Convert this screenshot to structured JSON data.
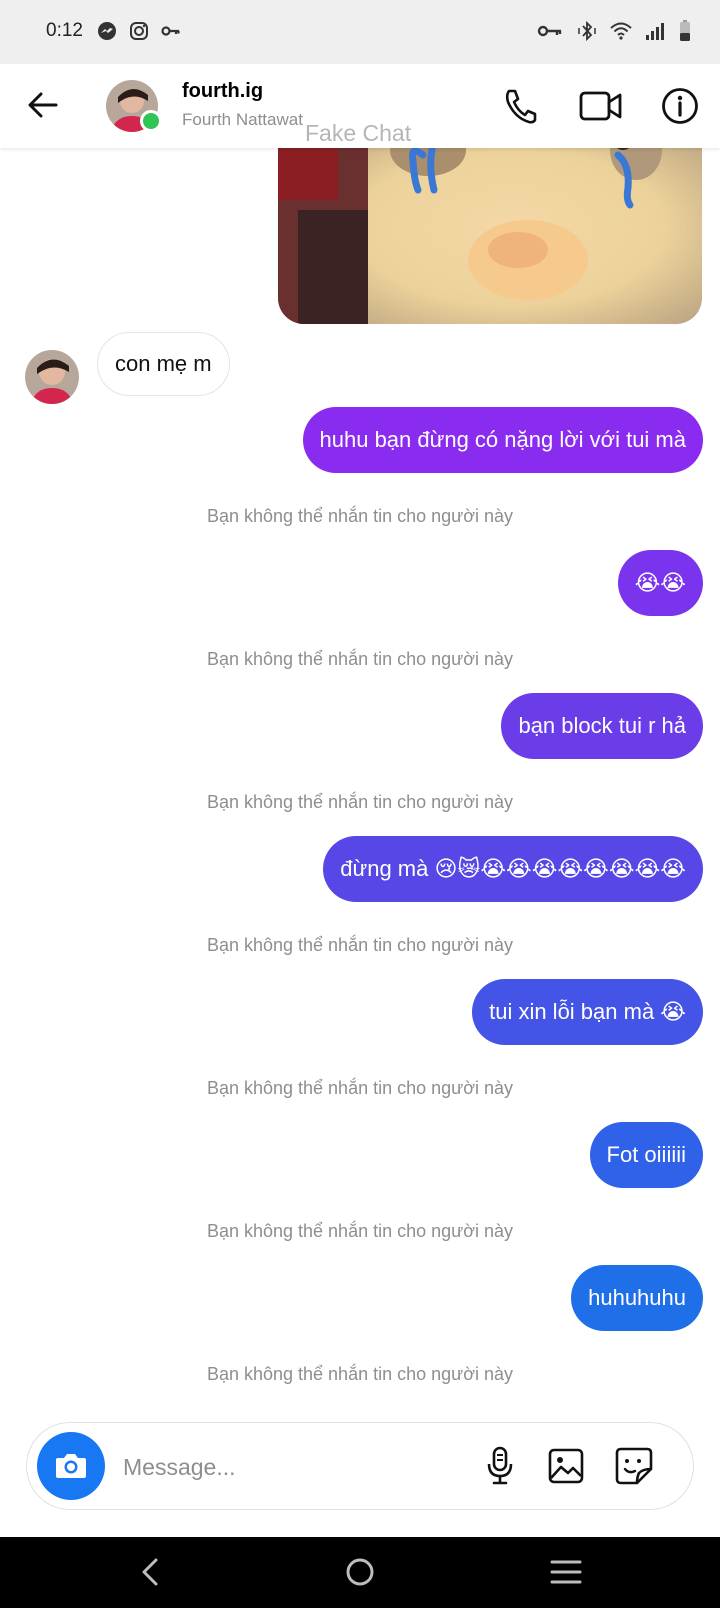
{
  "status_bar": {
    "time": "0:12",
    "left_icons": [
      "messenger-icon",
      "instagram-icon",
      "vpn-key-icon"
    ],
    "right_icons": [
      "vpn-key-icon",
      "bluetooth-vibrate-icon",
      "wifi-icon",
      "signal-icon",
      "battery-icon"
    ]
  },
  "header": {
    "name": "fourth.ig",
    "subtitle": "Fourth Nattawat",
    "watermark": "Fake Chat",
    "online": true
  },
  "messages": [
    {
      "dir": "in",
      "text": "con mẹ m"
    },
    {
      "dir": "out",
      "text": "huhu bạn đừng có nặng lời với tui mà",
      "color": "#8a2bf0"
    },
    {
      "dir": "notice",
      "text": "Bạn không thể nhắn tin cho người này"
    },
    {
      "dir": "out",
      "text": "😭😭",
      "color": "#7a34ee"
    },
    {
      "dir": "notice",
      "text": "Bạn không thể nhắn tin cho người này"
    },
    {
      "dir": "out",
      "text": "bạn block tui r hả",
      "color": "#6a3de9"
    },
    {
      "dir": "notice",
      "text": "Bạn không thể nhắn tin cho người này"
    },
    {
      "dir": "out",
      "text": "đừng mà 😢😿😭😭😭😭😭😭😭😭",
      "color": "#5747e6"
    },
    {
      "dir": "notice",
      "text": "Bạn không thể nhắn tin cho người này"
    },
    {
      "dir": "out",
      "text": "tui xin lỗi bạn mà 😭",
      "color": "#4454e6"
    },
    {
      "dir": "notice",
      "text": "Bạn không thể nhắn tin cho người này"
    },
    {
      "dir": "out",
      "text": "Fot oiiiiii",
      "color": "#2f62e8"
    },
    {
      "dir": "notice",
      "text": "Bạn không thể nhắn tin cho người này"
    },
    {
      "dir": "out",
      "text": "huhuhuhu",
      "color": "#1f6fe8"
    },
    {
      "dir": "notice",
      "text": "Bạn không thể nhắn tin cho người này"
    }
  ],
  "composer": {
    "placeholder": "Message...",
    "accent": "#1877f2"
  },
  "nav": {
    "icons": [
      "back-nav-icon",
      "home-nav-icon",
      "recents-nav-icon"
    ]
  }
}
